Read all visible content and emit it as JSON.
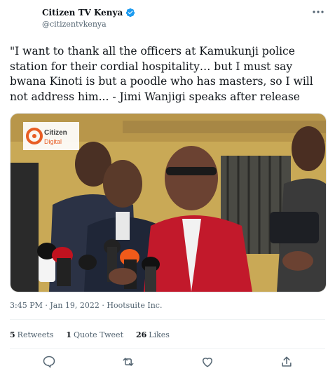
{
  "author": {
    "name": "Citizen TV Kenya",
    "handle": "@citizentvkenya"
  },
  "tweet": {
    "text": "\"I want to thank all the officers at Kamukunji police station for their cordial hospitality… but I must say bwana Kinoti is but a poodle who has masters, so I will not address him... - Jimi Wanjigi speaks after release"
  },
  "media": {
    "logo_line1": "Citizen",
    "logo_line2": "Digital"
  },
  "meta": {
    "time": "3:45 PM",
    "date": "Jan 19, 2022",
    "source": "Hootsuite Inc.",
    "separator": "·"
  },
  "stats": {
    "retweets_count": "5",
    "retweets_label": "Retweets",
    "quotes_count": "1",
    "quotes_label": "Quote Tweet",
    "likes_count": "26",
    "likes_label": "Likes"
  },
  "colors": {
    "verified": "#1d9bf0",
    "text": "#0f1419",
    "muted": "#536471",
    "logo_orange": "#e85d24"
  }
}
